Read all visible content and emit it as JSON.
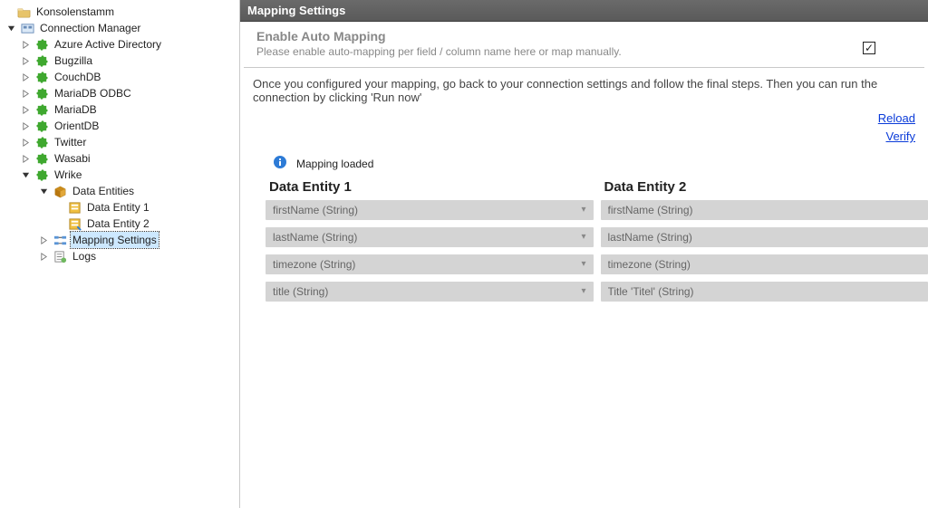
{
  "tree": {
    "root": "Konsolenstamm",
    "manager": "Connection Manager",
    "connections": [
      "Azure Active Directory",
      "Bugzilla",
      "CouchDB",
      "MariaDB ODBC",
      "MariaDB",
      "OrientDB",
      "Twitter",
      "Wasabi"
    ],
    "expanded_connection": "Wrike",
    "data_entities_label": "Data Entities",
    "data_entity_1": "Data Entity 1",
    "data_entity_2": "Data Entity 2",
    "mapping_settings": "Mapping Settings",
    "logs": "Logs"
  },
  "panel": {
    "title": "Mapping Settings",
    "auto_map_title": "Enable Auto Mapping",
    "auto_map_desc": "Please enable auto-mapping per field / column name here or map manually.",
    "auto_map_checked": "✓",
    "info_text": "Once you configured your mapping, go back to your connection settings and follow the final steps. Then you can run the connection by clicking 'Run now'",
    "link_reload": "Reload",
    "link_verify": "Verify",
    "status": "Mapping loaded",
    "entity1_heading": "Data Entity 1",
    "entity2_heading": "Data Entity 2",
    "rows1": [
      "firstName (String)",
      "lastName (String)",
      "timezone (String)",
      "title (String)"
    ],
    "rows2": [
      "firstName (String)",
      "lastName (String)",
      "timezone (String)",
      "Title 'Titel' (String)"
    ]
  }
}
